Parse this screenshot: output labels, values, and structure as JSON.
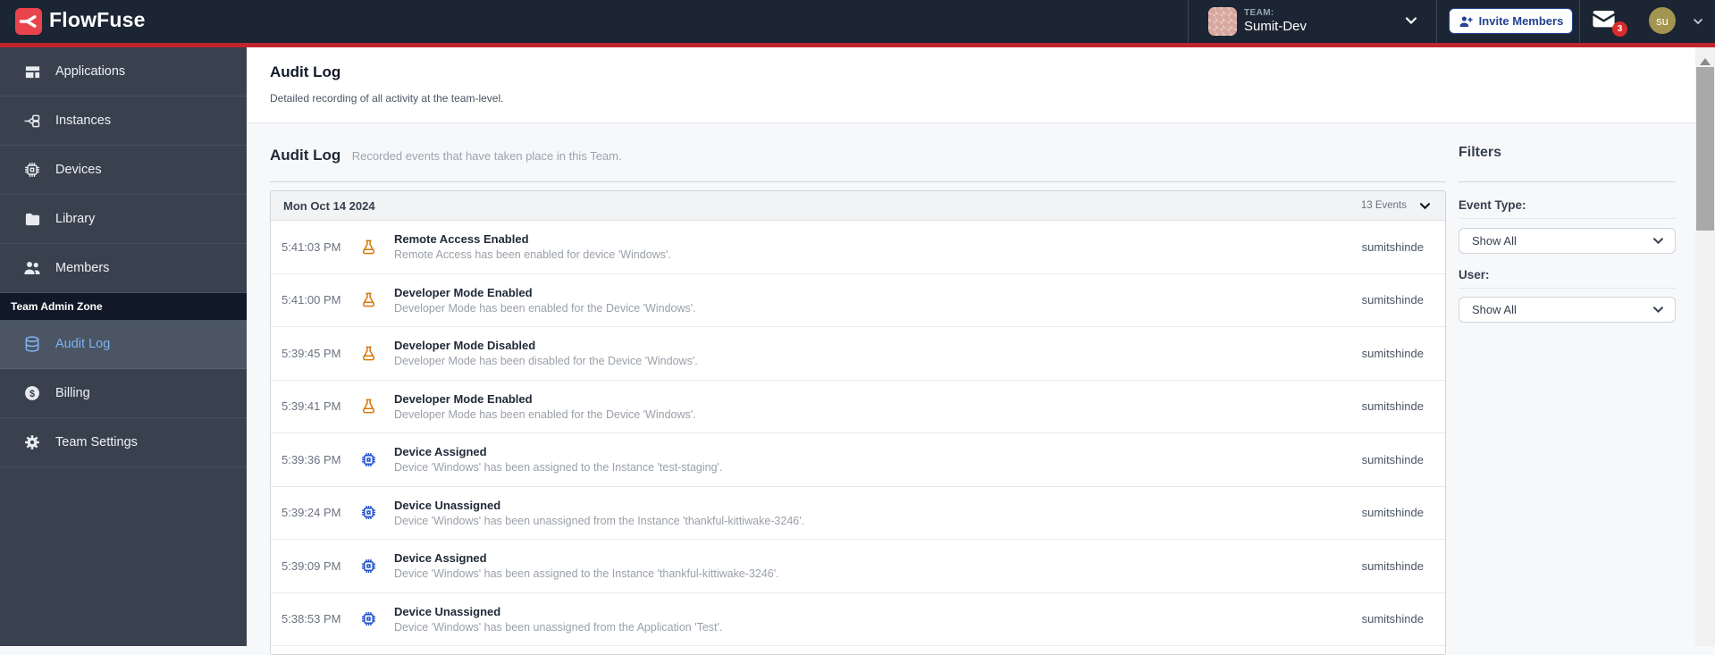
{
  "header": {
    "brand": "FlowFuse",
    "team": {
      "label": "TEAM:",
      "name": "Sumit-Dev"
    },
    "invite_button_label": "Invite Members",
    "notifications_badge": "3",
    "user_initials": "su"
  },
  "sidebar": {
    "main_items": [
      {
        "label": "Applications",
        "icon": "applications-icon"
      },
      {
        "label": "Instances",
        "icon": "instances-icon"
      },
      {
        "label": "Devices",
        "icon": "devices-icon"
      },
      {
        "label": "Library",
        "icon": "library-icon"
      },
      {
        "label": "Members",
        "icon": "members-icon"
      }
    ],
    "admin_section_label": "Team Admin Zone",
    "admin_items": [
      {
        "label": "Audit Log",
        "icon": "audit-log-icon",
        "selected": true
      },
      {
        "label": "Billing",
        "icon": "billing-icon",
        "selected": false
      },
      {
        "label": "Team Settings",
        "icon": "team-settings-icon",
        "selected": false
      }
    ]
  },
  "page_header": {
    "title": "Audit Log",
    "subtitle": "Detailed recording of all activity at the team-level."
  },
  "audit_section": {
    "title": "Audit Log",
    "subtitle": "Recorded events that have taken place in this Team."
  },
  "event_group": {
    "date": "Mon Oct 14 2024",
    "events_count": "13 Events"
  },
  "events": [
    {
      "time": "5:41:03 PM",
      "icon": "flask-icon",
      "title": "Remote Access Enabled",
      "description": "Remote Access has been enabled for device 'Windows'.",
      "user": "sumitshinde"
    },
    {
      "time": "5:41:00 PM",
      "icon": "flask-icon",
      "title": "Developer Mode Enabled",
      "description": "Developer Mode has been enabled for the Device 'Windows'.",
      "user": "sumitshinde"
    },
    {
      "time": "5:39:45 PM",
      "icon": "flask-icon",
      "title": "Developer Mode Disabled",
      "description": "Developer Mode has been disabled for the Device 'Windows'.",
      "user": "sumitshinde"
    },
    {
      "time": "5:39:41 PM",
      "icon": "flask-icon",
      "title": "Developer Mode Enabled",
      "description": "Developer Mode has been enabled for the Device 'Windows'.",
      "user": "sumitshinde"
    },
    {
      "time": "5:39:36 PM",
      "icon": "chip-icon",
      "title": "Device Assigned",
      "description": "Device 'Windows' has been assigned to the Instance 'test-staging'.",
      "user": "sumitshinde"
    },
    {
      "time": "5:39:24 PM",
      "icon": "chip-icon",
      "title": "Device Unassigned",
      "description": "Device 'Windows' has been unassigned from the Instance 'thankful-kittiwake-3246'.",
      "user": "sumitshinde"
    },
    {
      "time": "5:39:09 PM",
      "icon": "chip-icon",
      "title": "Device Assigned",
      "description": "Device 'Windows' has been assigned to the Instance 'thankful-kittiwake-3246'.",
      "user": "sumitshinde"
    },
    {
      "time": "5:38:53 PM",
      "icon": "chip-icon",
      "title": "Device Unassigned",
      "description": "Device 'Windows' has been unassigned from the Application 'Test'.",
      "user": "sumitshinde"
    }
  ],
  "filters": {
    "title": "Filters",
    "fields": [
      {
        "label": "Event Type:",
        "value": "Show All"
      },
      {
        "label": "User:",
        "value": "Show All"
      }
    ]
  },
  "colors": {
    "header_bg": "#1c2533",
    "accent_red_line": "#c0242c",
    "brand_red": "#e9444d",
    "invite_blue": "#24418f",
    "flask_orange": "#d97706",
    "chip_blue": "#2352cc",
    "selected_nav_blue": "#7eb1f0",
    "badge_red": "#d92c2c"
  }
}
